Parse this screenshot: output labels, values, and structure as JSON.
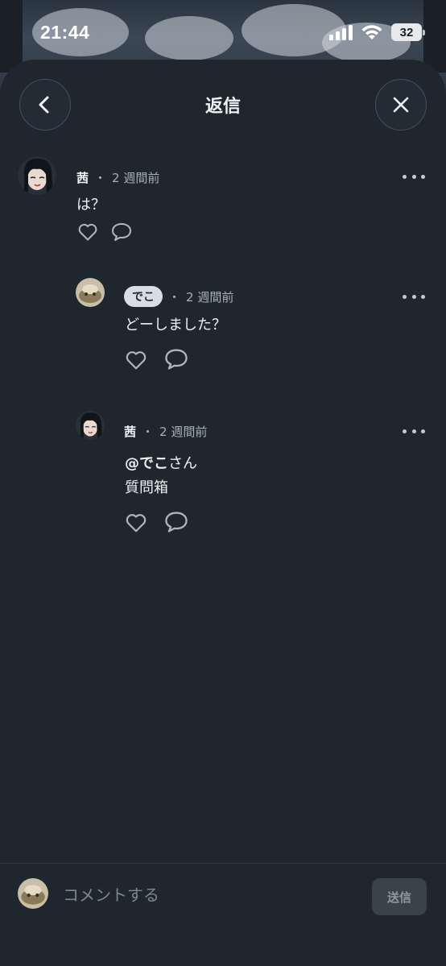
{
  "status_bar": {
    "time": "21:44",
    "battery": "32",
    "icons": [
      "signal-icon",
      "wifi-icon",
      "battery-icon"
    ]
  },
  "header": {
    "title": "返信",
    "back_icon": "chevron-left-icon",
    "close_icon": "close-icon"
  },
  "comments": [
    {
      "author": "茜",
      "time": "2 週間前",
      "separator": "・",
      "lines": [
        "は？"
      ],
      "actions": [
        "heart-icon",
        "comment-icon"
      ]
    },
    {
      "author": "でこ",
      "time": "2 週間前",
      "separator": "・",
      "lines": [
        "どーしました？"
      ],
      "actions": [
        "heart-icon",
        "comment-icon"
      ]
    },
    {
      "author": "茜",
      "time": "2 週間前",
      "separator": "・",
      "mention": "@でこ",
      "mention_suffix": "さん",
      "lines": [
        "質問箱"
      ],
      "actions": [
        "heart-icon",
        "comment-icon"
      ]
    }
  ],
  "composer": {
    "placeholder": "コメントする",
    "send_label": "送信"
  },
  "colors": {
    "sheet_bg": "#1f262d",
    "text": "#eef1f3",
    "muted": "#a6b0b8",
    "accent_border": "#3e5261"
  }
}
